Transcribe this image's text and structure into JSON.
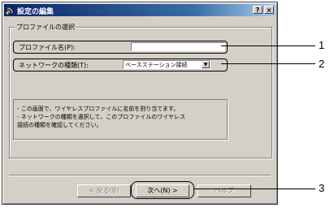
{
  "window": {
    "title": "設定の編集",
    "help_button": "?",
    "close_button": "×"
  },
  "profile_group": {
    "legend": "プロファイルの選択",
    "profile_name_label": "プロファイル名(P):",
    "profile_name_value": "",
    "network_type_label": "ネットワークの種類(T):",
    "network_type_value": "ベースステーション接続"
  },
  "help_text": {
    "line1": "- この画面で、ワイヤレスプロファイルに名前を割り当てます。",
    "line2": "- ネットワークの種類を選択して、このプロファイルのワイヤレス",
    "line3": "  接続の種類を確認してください。"
  },
  "buttons": {
    "back": "< 戻る(B)",
    "next": "次へ(N) >",
    "help": "ヘルプ"
  },
  "callouts": [
    "1",
    "2",
    "3"
  ],
  "icons": {
    "title": "wireless-signal-icon",
    "dropdown": "chevron-down-icon"
  }
}
